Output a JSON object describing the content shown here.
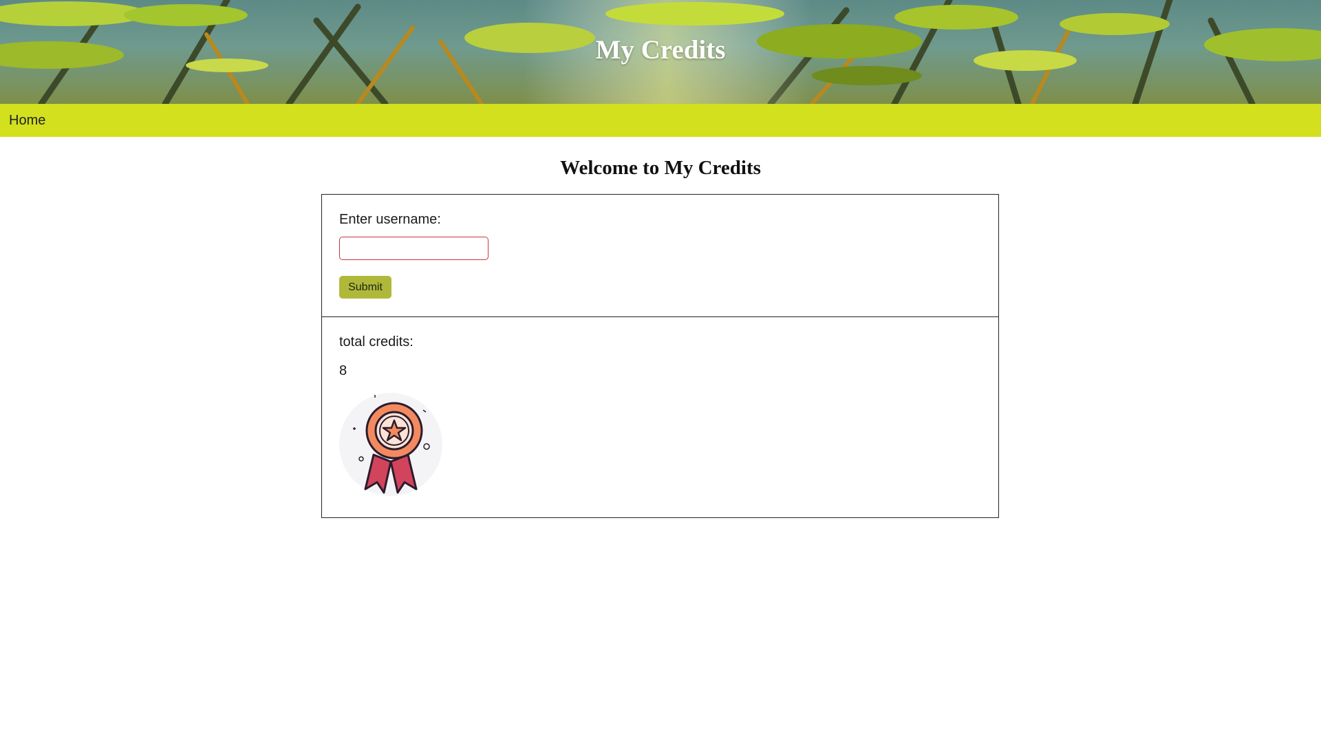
{
  "header": {
    "title": "My Credits"
  },
  "nav": {
    "home_label": "Home"
  },
  "main": {
    "welcome_heading": "Welcome to My Credits"
  },
  "form": {
    "username_label": "Enter username:",
    "username_value": "",
    "submit_label": "Submit"
  },
  "credits": {
    "label": "total credits:",
    "value": "8",
    "badge_icon": "award-ribbon-icon"
  },
  "colors": {
    "nav_background": "#d2e01e",
    "submit_background": "#b0b83a",
    "input_border": "#c9343e",
    "badge_ring": "#f38a5f",
    "badge_ribbon": "#d2435c"
  }
}
